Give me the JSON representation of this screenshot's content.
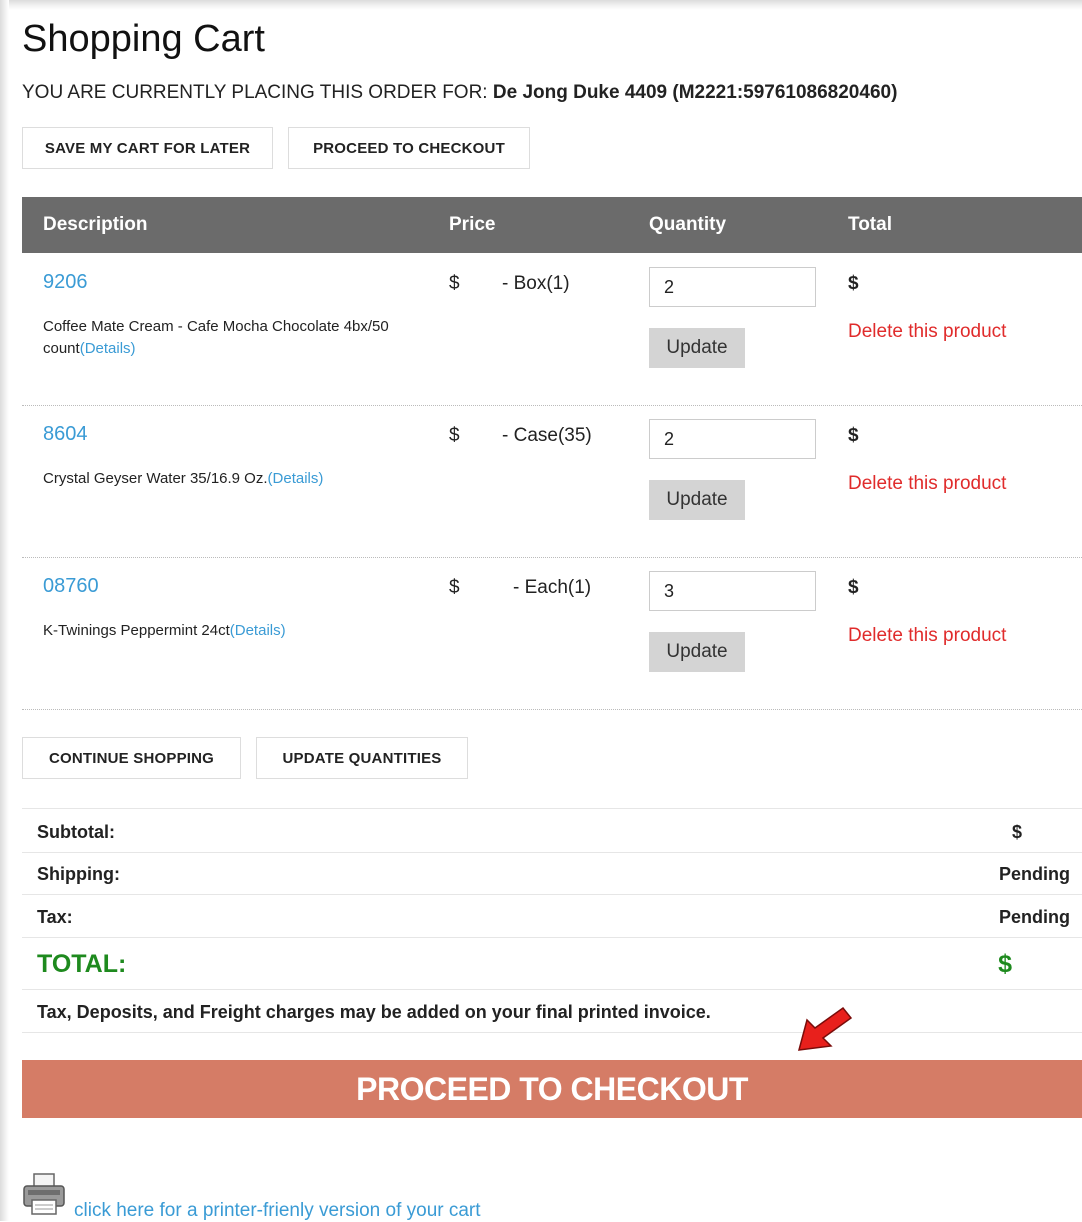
{
  "page": {
    "title": "Shopping Cart",
    "placing_prefix": "YOU ARE CURRENTLY PLACING THIS ORDER FOR:",
    "placing_customer": "De Jong Duke 4409 (M2221:59761086820460)"
  },
  "toolbar": {
    "save_label": "SAVE MY CART FOR LATER",
    "checkout_label": "PROCEED TO CHECKOUT"
  },
  "table": {
    "headers": {
      "description": "Description",
      "price": "Price",
      "quantity": "Quantity",
      "total": "Total"
    },
    "rows": [
      {
        "sku": "9206",
        "description": "Coffee Mate Cream - Cafe Mocha Chocolate 4bx/50 count",
        "details_label": "(Details)",
        "price": "$",
        "unit": "- Box(1)",
        "quantity": "2",
        "update_label": "Update",
        "total": "$",
        "delete_label": "Delete this product"
      },
      {
        "sku": "8604",
        "description": "Crystal Geyser Water 35/16.9 Oz.",
        "details_label": "(Details)",
        "price": "$",
        "unit": "- Case(35)",
        "quantity": "2",
        "update_label": "Update",
        "total": "$",
        "delete_label": "Delete this product"
      },
      {
        "sku": "08760",
        "description": "K-Twinings Peppermint 24ct",
        "details_label": "(Details)",
        "price": "$",
        "unit": "- Each(1)",
        "quantity": "3",
        "update_label": "Update",
        "total": "$",
        "delete_label": "Delete this product"
      }
    ]
  },
  "actions": {
    "continue_label": "CONTINUE SHOPPING",
    "update_quantities_label": "UPDATE QUANTITIES"
  },
  "summary": {
    "subtotal_label": "Subtotal:",
    "subtotal_value": "$",
    "shipping_label": "Shipping:",
    "shipping_value": "Pending",
    "tax_label": "Tax:",
    "tax_value": "Pending",
    "total_label": "TOTAL:",
    "total_value": "$",
    "note": "Tax, Deposits, and Freight charges may be added on your final printed invoice."
  },
  "checkout": {
    "label": "PROCEED TO CHECKOUT"
  },
  "print": {
    "link_label": "click here for a printer-frienly version of your cart"
  },
  "colors": {
    "header_bg": "#6b6b6b",
    "link": "#3a9bd5",
    "delete": "#e02b2b",
    "total_green": "#1e8a1e",
    "checkout_bg": "#d57c66",
    "arrow": "#e8201c"
  },
  "icons": {
    "arrow": "red-arrow-icon",
    "printer": "printer-icon"
  }
}
